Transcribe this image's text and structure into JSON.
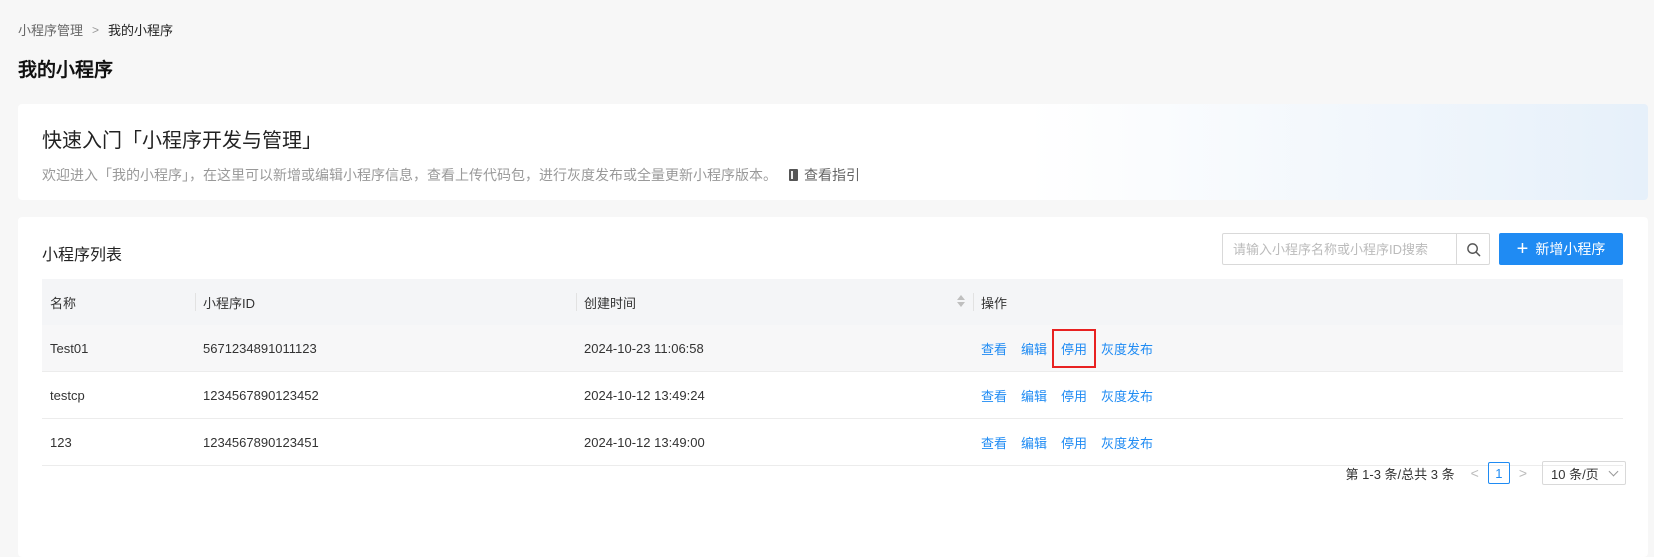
{
  "breadcrumb": {
    "root": "小程序管理",
    "separator": ">",
    "current": "我的小程序"
  },
  "page_title": "我的小程序",
  "intro": {
    "title": "快速入门「小程序开发与管理」",
    "description": "欢迎进入「我的小程序」，在这里可以新增或编辑小程序信息，查看上传代码包，进行灰度发布或全量更新小程序版本。",
    "guide_label": "查看指引"
  },
  "list": {
    "title": "小程序列表",
    "search_placeholder": "请输入小程序名称或小程序ID搜索",
    "add_label": "新增小程序",
    "columns": {
      "name": "名称",
      "id": "小程序ID",
      "created": "创建时间",
      "actions": "操作"
    },
    "rows": [
      {
        "name": "Test01",
        "id": "5671234891011123",
        "created": "2024-10-23 11:06:58",
        "view": "查看",
        "edit": "编辑",
        "disable": "停用",
        "gray": "灰度发布"
      },
      {
        "name": "testcp",
        "id": "1234567890123452",
        "created": "2024-10-12 13:49:24",
        "view": "查看",
        "edit": "编辑",
        "disable": "停用",
        "gray": "灰度发布"
      },
      {
        "name": "123",
        "id": "1234567890123451",
        "created": "2024-10-12 13:49:00",
        "view": "查看",
        "edit": "编辑",
        "disable": "停用",
        "gray": "灰度发布"
      }
    ]
  },
  "pagination": {
    "summary": "第 1-3 条/总共 3 条",
    "prev": "<",
    "current_page": "1",
    "next": ">",
    "page_size": "10 条/页"
  },
  "colors": {
    "primary": "#1f8bf3",
    "highlight_border": "#e82121"
  }
}
